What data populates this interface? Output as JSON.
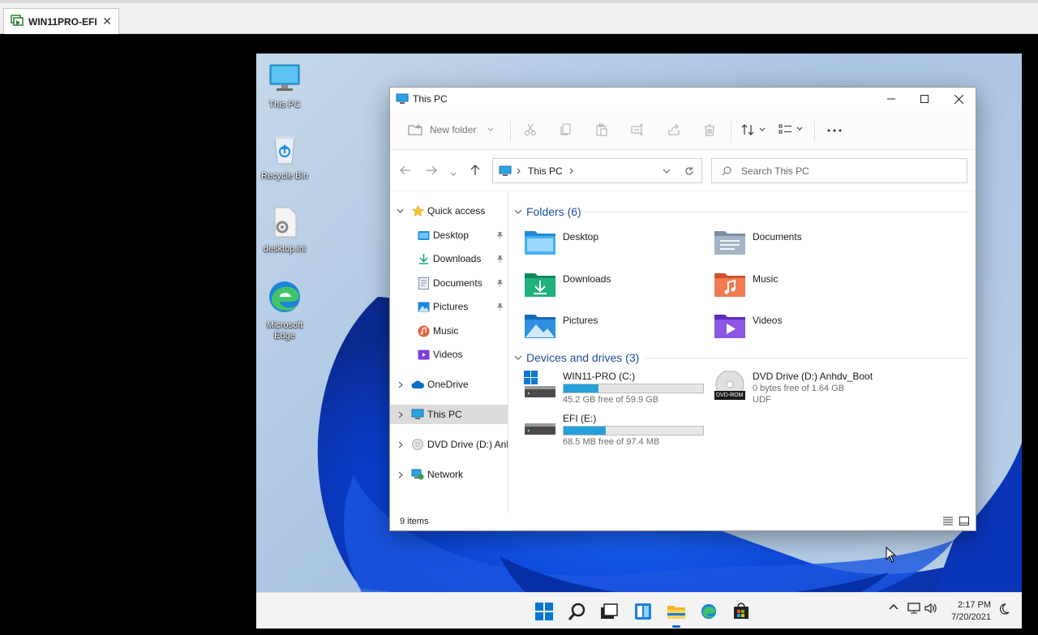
{
  "vm_tab": {
    "title": "WIN11PRO-EFI",
    "close": "✕"
  },
  "desktop_icons": [
    {
      "label": "This PC"
    },
    {
      "label": "Recycle Bin"
    },
    {
      "label": "desktop.ini"
    },
    {
      "label": "Microsoft Edge"
    }
  ],
  "explorer": {
    "title": "This PC",
    "toolbar": {
      "new_folder": "New folder"
    },
    "address": {
      "location": "This PC"
    },
    "search": {
      "placeholder": "Search This PC"
    },
    "nav": {
      "quick_access": "Quick access",
      "quick_items": [
        "Desktop",
        "Downloads",
        "Documents",
        "Pictures",
        "Music",
        "Videos"
      ],
      "onedrive": "OneDrive",
      "this_pc": "This PC",
      "dvd": "DVD Drive (D:) Anhdv_Boot",
      "network": "Network"
    },
    "folders_header": "Folders (6)",
    "folders": [
      "Desktop",
      "Documents",
      "Downloads",
      "Music",
      "Pictures",
      "Videos"
    ],
    "devices_header": "Devices and drives (3)",
    "drives": [
      {
        "name": "WIN11-PRO (C:)",
        "free": "45.2 GB free of 59.9 GB",
        "used_fraction": 0.25
      },
      {
        "name": "EFI (E:)",
        "free": "68.5 MB free of 97.4 MB",
        "used_fraction": 0.3
      }
    ],
    "dvd_drive": {
      "name": "DVD Drive (D:) Anhdv_Boot",
      "free": "0 bytes free of 1.64 GB",
      "fs": "UDF",
      "badge": "DVD-ROM"
    },
    "status": "9 items"
  },
  "clock": {
    "time": "2:17 PM",
    "date": "7/20/2021"
  },
  "colors": {
    "accent": "#0067c0",
    "drive_bar": "#26a0da",
    "group_header": "#1e4f9c"
  }
}
